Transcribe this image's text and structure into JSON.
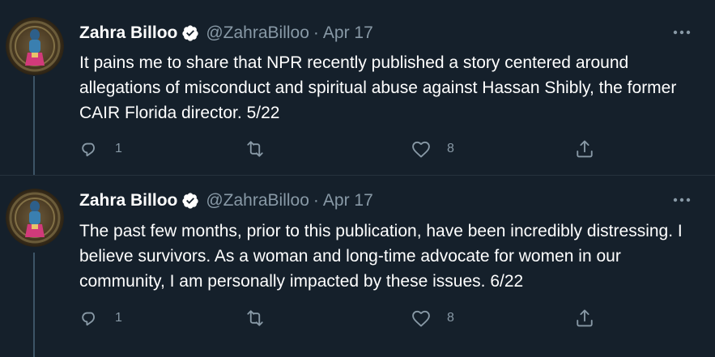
{
  "tweets": [
    {
      "author": "Zahra Billoo",
      "handle": "@ZahraBilloo",
      "separator": "·",
      "date": "Apr 17",
      "text": "It pains me to share that NPR recently published a story centered around allegations of misconduct and spiritual abuse against Hassan Shibly, the former CAIR Florida director. 5/22",
      "reply_count": "1",
      "retweet_count": "",
      "like_count": "8"
    },
    {
      "author": "Zahra Billoo",
      "handle": "@ZahraBilloo",
      "separator": "·",
      "date": "Apr 17",
      "text": "The past few months, prior to this publication, have been incredibly distressing. I believe survivors. As a woman and long-time advocate for women in our community, I am personally impacted by these issues. 6/22",
      "reply_count": "1",
      "retweet_count": "",
      "like_count": "8"
    }
  ],
  "colors": {
    "background": "#15202b",
    "text_primary": "#ffffff",
    "text_secondary": "#8899a6",
    "thread_line": "#3d5466"
  },
  "icons": [
    "verified-badge-icon",
    "more-icon",
    "reply-icon",
    "retweet-icon",
    "like-icon",
    "share-icon"
  ]
}
